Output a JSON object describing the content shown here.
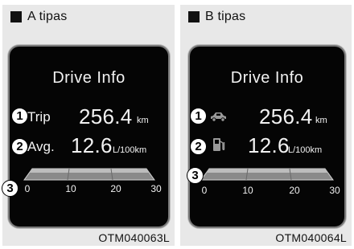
{
  "panels": [
    {
      "title": "A tipas",
      "screen_title": "Drive Info",
      "badges": [
        "1",
        "2",
        "3"
      ],
      "trip_label": "Trip",
      "trip_value": "256.4",
      "trip_unit": "km",
      "avg_label": "Avg.",
      "avg_value": "12.6",
      "avg_unit": "L/100km",
      "scale_ticks": [
        "0",
        "10",
        "20",
        "30"
      ],
      "caption": "OTM040063L"
    },
    {
      "title": "B tipas",
      "screen_title": "Drive Info",
      "badges": [
        "1",
        "2",
        "3"
      ],
      "trip_icon": "car-icon",
      "trip_value": "256.4",
      "trip_unit": "km",
      "avg_icon": "fuel-pump-icon",
      "avg_value": "12.6",
      "avg_unit": "L/100km",
      "scale_ticks": [
        "0",
        "10",
        "20",
        "30"
      ],
      "caption": "OTM040064L"
    }
  ],
  "colors": {
    "screen": "#050505",
    "text": "#f2f2f2",
    "panel_bg": "#e8e8e8"
  }
}
